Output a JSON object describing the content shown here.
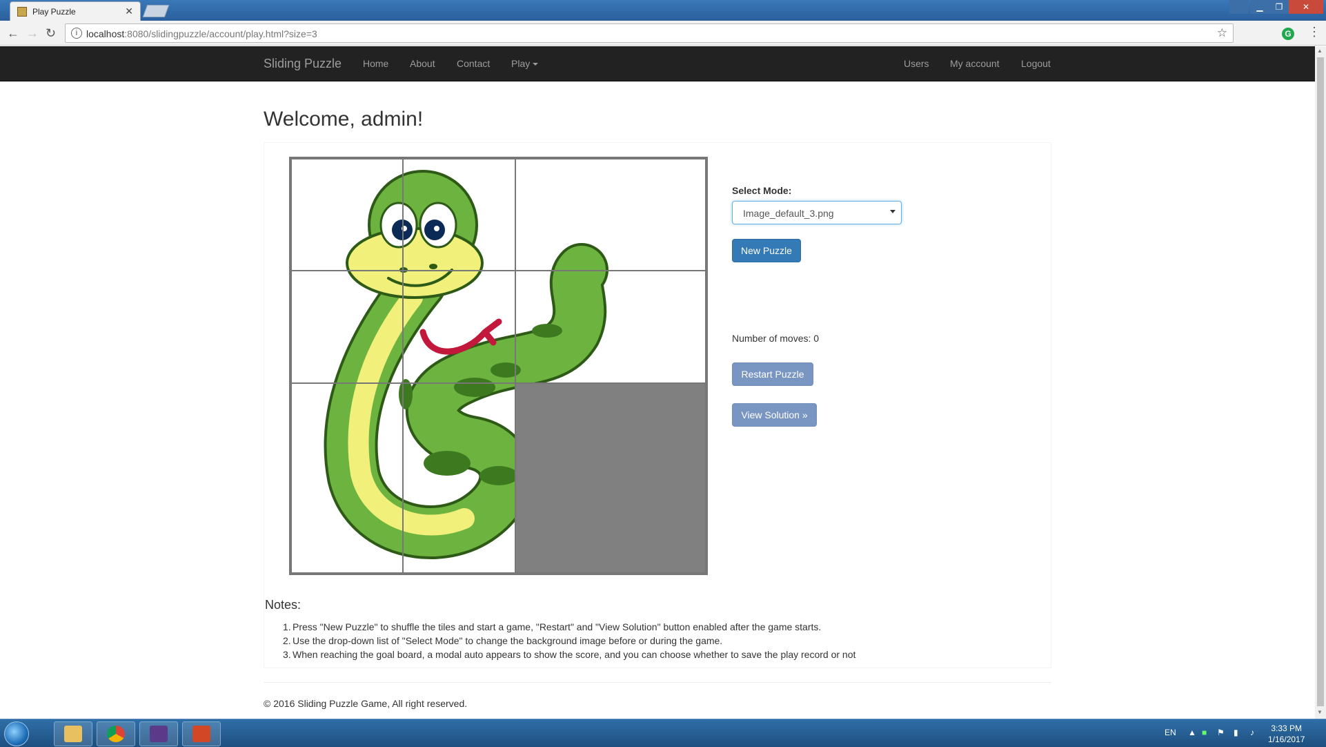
{
  "browser": {
    "tab_title": "Play Puzzle",
    "tab_close": "✕",
    "url_host": "localhost",
    "url_rest": ":8080/slidingpuzzle/account/play.html?size=3",
    "info_icon": "i",
    "star_icon": "☆",
    "ext_icon": "G",
    "menu_icon": "⋮",
    "back_icon": "←",
    "forward_icon": "→",
    "reload_icon": "↻",
    "win_min": "▁",
    "win_restore": "❐",
    "win_close": "✕"
  },
  "navbar": {
    "brand": "Sliding Puzzle",
    "links": [
      "Home",
      "About",
      "Contact",
      "Play"
    ],
    "right_links": [
      "Users",
      "My account",
      "Logout"
    ]
  },
  "main": {
    "welcome": "Welcome, admin!",
    "select_label": "Select Mode:",
    "select_value": "Image_default_3.png",
    "new_puzzle": "New Puzzle",
    "moves_label": "Number of moves: 0",
    "restart": "Restart Puzzle",
    "view_solution": "View Solution »"
  },
  "notes": {
    "heading": "Notes:",
    "items": [
      "Press \"New Puzzle\" to shuffle the tiles and start a game, \"Restart\" and \"View Solution\" button enabled after the game starts.",
      "Use the drop-down list of \"Select Mode\" to change the background image before or during the game.",
      "When reaching the goal board, a modal auto appears to show the score, and you can choose whether to save the play record or not"
    ]
  },
  "footer": {
    "text": "© 2016 Sliding Puzzle Game, All right reserved."
  },
  "taskbar": {
    "lang": "EN",
    "time": "3:33 PM",
    "date": "1/16/2017",
    "apps": [
      "file-explorer",
      "chrome",
      "ide",
      "presentation"
    ]
  },
  "colors": {
    "navbar_bg": "#222222",
    "primary": "#337ab7",
    "disabled_btn": "#7996c2",
    "empty_tile": "#808080",
    "snake_green": "#6db33f",
    "snake_belly": "#f0f07a"
  }
}
